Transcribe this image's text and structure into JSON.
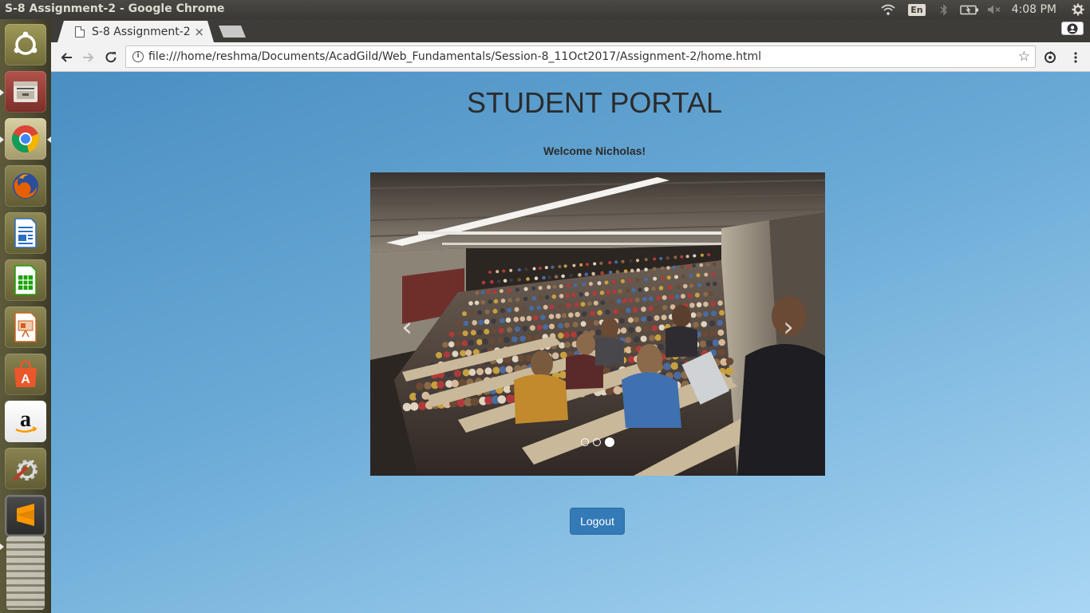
{
  "top_panel": {
    "window_title": "S-8 Assignment-2 - Google Chrome",
    "keyboard_layout": "En",
    "clock": "4:08 PM",
    "indicator_icons": [
      "wifi-icon",
      "keyboard-layout-indicator",
      "bluetooth-icon",
      "battery-icon",
      "volume-muted-icon",
      "settings-gear-icon"
    ]
  },
  "launcher": {
    "items": [
      "ubuntu-dash",
      "files",
      "google-chrome",
      "firefox",
      "libreoffice-writer",
      "libreoffice-calc",
      "libreoffice-impress",
      "ubuntu-software",
      "amazon",
      "system-settings",
      "sublime-text",
      "trash"
    ]
  },
  "browser": {
    "tab_title": "S-8 Assignment-2",
    "tab_close": "×",
    "url": "file:///home/reshma/Documents/AcadGild/Web_Fundamentals/Session-8_11Oct2017/Assignment-2/home.html",
    "info_icon": "i",
    "star": "☆"
  },
  "page": {
    "heading": "STUDENT PORTAL",
    "welcome": "Welcome Nicholas!",
    "carousel": {
      "prev": "‹",
      "next": "›",
      "slide_count": 3,
      "active_slide": 3,
      "image": "lecture-hall-photo"
    },
    "logout_label": "Logout"
  }
}
